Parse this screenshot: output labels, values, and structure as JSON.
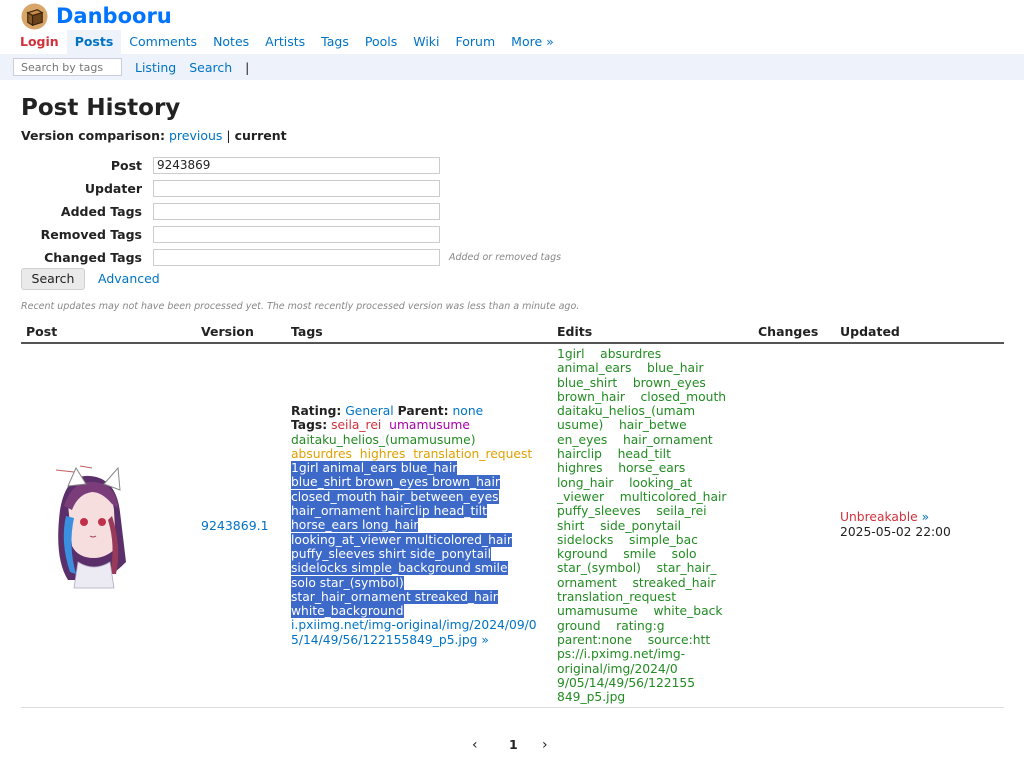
{
  "site": {
    "name": "Danbooru"
  },
  "nav": {
    "items": [
      "Login",
      "Posts",
      "Comments",
      "Notes",
      "Artists",
      "Tags",
      "Pools",
      "Wiki",
      "Forum",
      "More »"
    ]
  },
  "subnav": {
    "search_placeholder": "Search by tags",
    "listing": "Listing",
    "search": "Search",
    "separator": "|"
  },
  "page": {
    "title": "Post History",
    "comparison_label": "Version comparison:",
    "comparison_previous": "previous",
    "comparison_sep": "|",
    "comparison_current": "current"
  },
  "form": {
    "post_label": "Post",
    "post_value": "9243869",
    "updater_label": "Updater",
    "added_label": "Added Tags",
    "removed_label": "Removed Tags",
    "changed_label": "Changed Tags",
    "changed_hint": "Added or removed tags",
    "search_button": "Search",
    "advanced": "Advanced",
    "notice": "Recent updates may not have been processed yet. The most recently processed version was less than a minute ago."
  },
  "table": {
    "headers": [
      "Post",
      "Version",
      "Tags",
      "Edits",
      "Changes",
      "Updated"
    ],
    "row": {
      "version": "9243869.1",
      "rating_label": "Rating:",
      "rating_value": "General",
      "parent_label": "Parent:",
      "parent_value": "none",
      "tags_label": "Tags:",
      "artist_tags": [
        "seila_rei"
      ],
      "copyright_tags": [
        "umamusume",
        "daitaku_helios_(umamusume)"
      ],
      "meta_tags": [
        "absurdres",
        "highres",
        "translation_request"
      ],
      "general_lines": [
        [
          "1girl",
          "animal_ears",
          "blue_hair"
        ],
        [
          "blue_shirt",
          "brown_eyes",
          "brown_hair"
        ],
        [
          "closed_mouth",
          "hair_between_eyes"
        ],
        [
          "hair_ornament",
          "hairclip",
          "head_tilt"
        ],
        [
          "horse_ears",
          "long_hair"
        ],
        [
          "looking_at_viewer",
          "multicolored_hair"
        ],
        [
          "puffy_sleeves",
          "shirt",
          "side_ponytail"
        ],
        [
          "sidelocks",
          "simple_background",
          "smile"
        ],
        [
          "solo",
          "star_(symbol)"
        ],
        [
          "star_hair_ornament",
          "streaked_hair"
        ],
        [
          "white_background"
        ]
      ],
      "source_lines": [
        "i.pxiimg.net/img-original/img/2024/09/0",
        "5/14/49/56/122155849_p5.jpg »"
      ],
      "edits_lines": [
        "1girl    absurdres",
        "animal_ears    blue_hair",
        "blue_shirt    brown_eyes",
        "brown_hair    closed_mouth",
        "daitaku_helios_(umam",
        "usume)    hair_betwe",
        "en_eyes    hair_ornament",
        "hairclip    head_tilt",
        "highres    horse_ears",
        "long_hair    looking_at",
        "_viewer    multicolored_hair",
        "puffy_sleeves    seila_rei",
        "shirt    side_ponytail",
        "sidelocks    simple_bac",
        "kground    smile    solo",
        "star_(symbol)    star_hair_",
        "ornament    streaked_hair",
        "translation_request",
        "umamusume    white_back",
        "ground    rating:g",
        "parent:none    source:htt",
        "ps://i.pximg.net/img-",
        "original/img/2024/0",
        "9/05/14/49/56/122155",
        "849_p5.jpg"
      ],
      "updater": "Unbreakable",
      "updater_arrow": "»",
      "updated_at": "2025-05-02 22:00"
    }
  },
  "pagination": {
    "prev": "‹",
    "current": "1",
    "next": "›"
  },
  "colors": {
    "link": "#0073c4",
    "login": "#d2303b",
    "artist": "#d2303b",
    "copyright": "#a800aa",
    "character": "#228b22",
    "meta": "#e0a000",
    "selection": "#3d69c9",
    "subnav_bg": "#eef3fb"
  }
}
